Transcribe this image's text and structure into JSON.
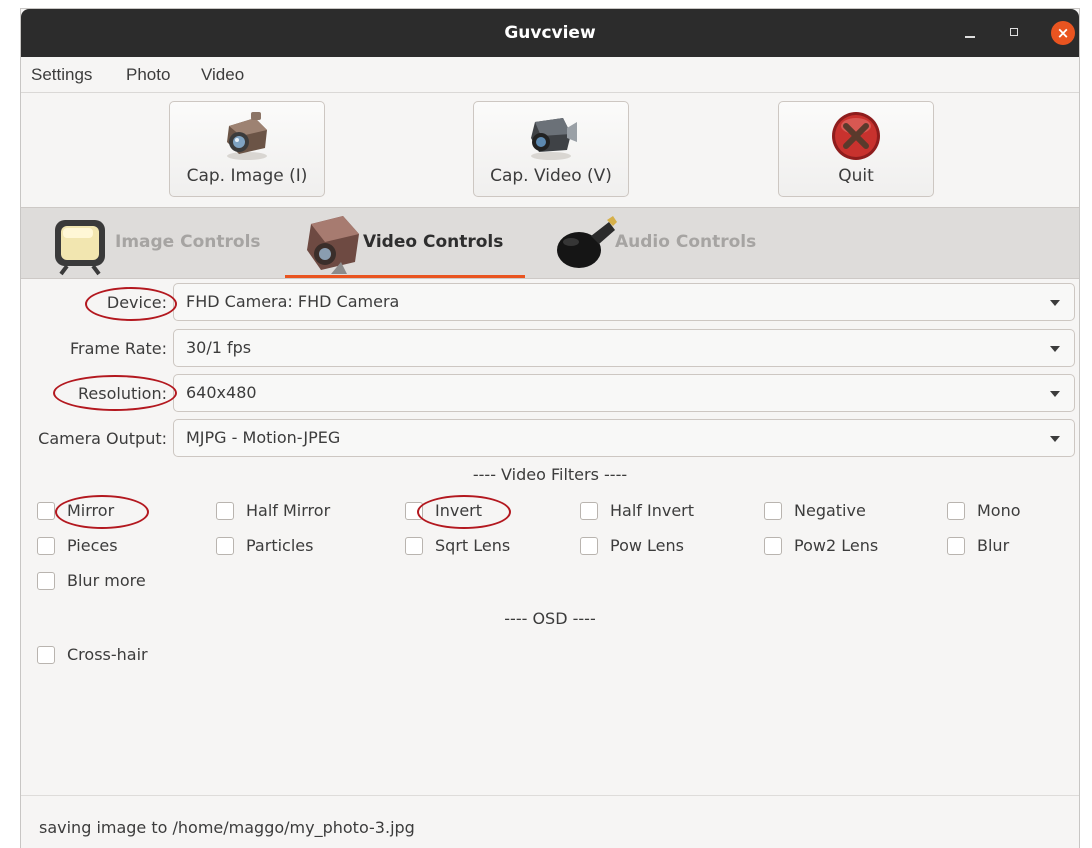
{
  "window": {
    "title": "Guvcview",
    "close_glyph": "×"
  },
  "menu": [
    "Settings",
    "Photo",
    "Video"
  ],
  "toolbar": {
    "cap_image": {
      "label": "Cap. Image (I)",
      "icon": "photo-camera-icon"
    },
    "cap_video": {
      "label": "Cap. Video (V)",
      "icon": "video-camera-icon"
    },
    "quit": {
      "label": "Quit",
      "icon": "quit-icon"
    }
  },
  "tabs": [
    {
      "label": "Image Controls",
      "icon": "monitor-icon",
      "active": false
    },
    {
      "label": "Video Controls",
      "icon": "video-camera-icon",
      "active": true
    },
    {
      "label": "Audio Controls",
      "icon": "microphone-icon",
      "active": false
    }
  ],
  "form": {
    "device": {
      "label": "Device:",
      "value": "FHD Camera: FHD Camera"
    },
    "frame_rate": {
      "label": "Frame Rate:",
      "value": "30/1 fps"
    },
    "resolution": {
      "label": "Resolution:",
      "value": "640x480"
    },
    "camera_output": {
      "label": "Camera Output:",
      "value": "MJPG - Motion-JPEG"
    }
  },
  "video_filters": {
    "title": "---- Video Filters ----",
    "items": [
      {
        "label": "Mirror",
        "checked": false
      },
      {
        "label": "Half Mirror",
        "checked": false
      },
      {
        "label": "Invert",
        "checked": false
      },
      {
        "label": "Half Invert",
        "checked": false
      },
      {
        "label": "Negative",
        "checked": false
      },
      {
        "label": "Mono",
        "checked": false
      },
      {
        "label": "Pieces",
        "checked": false
      },
      {
        "label": "Particles",
        "checked": false
      },
      {
        "label": "Sqrt Lens",
        "checked": false
      },
      {
        "label": "Pow Lens",
        "checked": false
      },
      {
        "label": "Pow2 Lens",
        "checked": false
      },
      {
        "label": "Blur",
        "checked": false
      },
      {
        "label": "Blur more",
        "checked": false
      }
    ]
  },
  "osd": {
    "title": "---- OSD ----",
    "items": [
      {
        "label": "Cross-hair",
        "checked": false
      }
    ]
  },
  "status": {
    "text": "saving image to /home/maggo/my_photo-3.jpg"
  },
  "colors": {
    "accent": "#e95420",
    "annotation": "#b3181f",
    "titlebar": "#2c2c2c"
  }
}
